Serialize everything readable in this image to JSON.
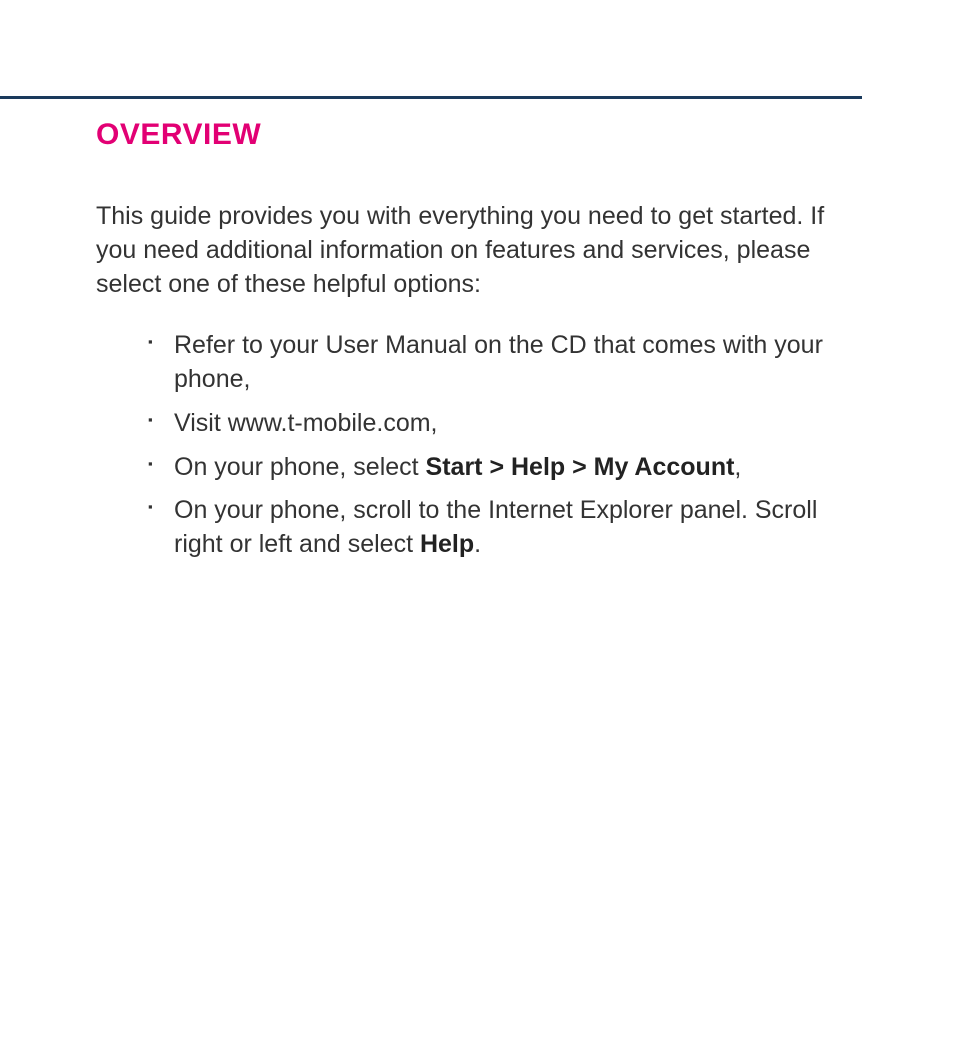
{
  "heading": "OVERVIEW",
  "intro": "This guide provides you with everything you need to get started. If you need additional information on features and services, please select one of these helpful options:",
  "bullets": {
    "b1": "Refer to your User Manual on the CD that comes with your phone,",
    "b2": "Visit www.t-mobile.com,",
    "b3_prefix": "On your phone, select ",
    "b3_bold": "Start > Help > My Account",
    "b3_suffix": ",",
    "b4_prefix": "On your phone, scroll to the Internet Explorer panel. Scroll right or left and select ",
    "b4_bold": "Help",
    "b4_suffix": "."
  }
}
